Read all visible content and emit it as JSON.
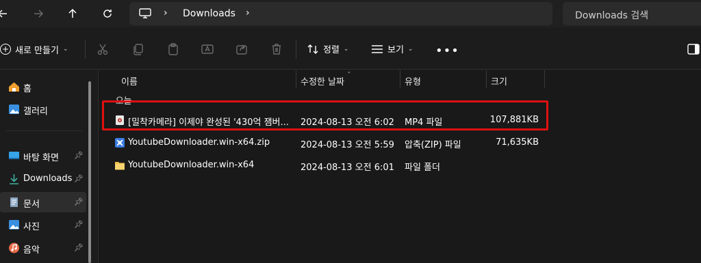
{
  "address": {
    "crumb": "Downloads",
    "search_placeholder": "Downloads 검색"
  },
  "commands": {
    "new_label": "새로 만들기",
    "sort_label": "정렬",
    "view_label": "보기",
    "more_label": "•••"
  },
  "sidebar": {
    "items": [
      {
        "label": "홈",
        "icon": "home-icon",
        "pinned": false
      },
      {
        "label": "갤러리",
        "icon": "gallery-icon",
        "pinned": false
      },
      {
        "label": "바탕 화면",
        "icon": "desktop-icon",
        "pinned": true
      },
      {
        "label": "Downloads",
        "icon": "download-icon",
        "pinned": true
      },
      {
        "label": "문서",
        "icon": "document-icon",
        "pinned": true
      },
      {
        "label": "사진",
        "icon": "pictures-icon",
        "pinned": true
      },
      {
        "label": "음악",
        "icon": "music-icon",
        "pinned": true
      }
    ]
  },
  "columns": {
    "name": "이름",
    "modified": "수정한 날짜",
    "type": "유형",
    "size": "크기"
  },
  "group": {
    "label": "오늘"
  },
  "files": [
    {
      "name": "[밀착카메라] 이제야 완성된 '430억 잼버...",
      "modified": "2024-08-13 오전 6:02",
      "type": "MP4 파일",
      "size": "107,881KB",
      "icon": "video-file-icon"
    },
    {
      "name": "YoutubeDownloader.win-x64.zip",
      "modified": "2024-08-13 오전 5:59",
      "type": "압축(ZIP) 파일",
      "size": "71,635KB",
      "icon": "zip-file-icon"
    },
    {
      "name": "YoutubeDownloader.win-x64",
      "modified": "2024-08-13 오전 6:01",
      "type": "파일 폴더",
      "size": "",
      "icon": "folder-icon"
    }
  ],
  "colors": {
    "highlight": "#e01010",
    "folder": "#f2c14e",
    "accent": "#4aa3f0"
  }
}
